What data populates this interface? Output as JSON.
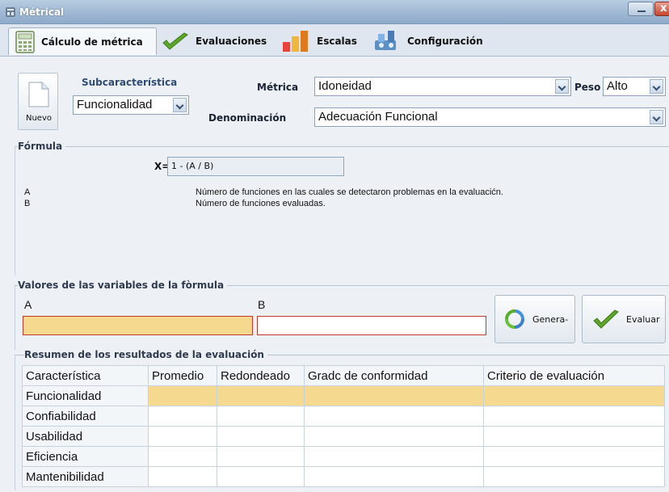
{
  "window": {
    "title": "Métrical",
    "close_glyph": "x"
  },
  "tabs": [
    {
      "label": "Cálculo de métrica",
      "icon": "calculator-icon"
    },
    {
      "label": "Evaluaciones",
      "icon": "checkmark-icon"
    },
    {
      "label": "Escalas",
      "icon": "bar-chart-icon"
    },
    {
      "label": "Configuración",
      "icon": "settings-icon"
    }
  ],
  "form": {
    "new_button": "Nuevo",
    "subcharacteristic_label": "Subcaracterística",
    "subcharacteristic_value": "Funcionalidad",
    "metric_label": "Métrica",
    "metric_value": "Idoneidad",
    "weight_label": "Peso",
    "weight_value": "Alto",
    "denomination_label": "Denominación",
    "denomination_value": "Adecuación Funcional"
  },
  "formula": {
    "section_title": "Fórmula",
    "x_label": "X=",
    "expression": "1 - (A / B)",
    "variables": [
      {
        "name": "A",
        "description": "Número de funciones en las cuales se detectaron problemas en la evaluacićn."
      },
      {
        "name": "B",
        "description": "Número de funciones evaluadas."
      }
    ]
  },
  "variables_section": {
    "title": "Valores de las variables de la fòrmula",
    "a_label": "A",
    "b_label": "B",
    "a_value": "",
    "b_value": "",
    "generate_button": "Genera-",
    "evaluate_button": "Evaluar"
  },
  "results": {
    "title": "Resumen de los resultados de la evaluación",
    "columns": [
      "Característica",
      "Promedio",
      "Redondeado",
      "Gradc de conformidad",
      "Criterio de evaluación"
    ],
    "rows": [
      {
        "name": "Funcionalidad",
        "cells": [
          "",
          "",
          "",
          ""
        ]
      },
      {
        "name": "Confiabilidad",
        "cells": [
          "",
          "",
          "",
          ""
        ]
      },
      {
        "name": "Usabilidad",
        "cells": [
          "",
          "",
          "",
          ""
        ]
      },
      {
        "name": "Eficiencia",
        "cells": [
          "",
          "",
          "",
          ""
        ]
      },
      {
        "name": "Mantenibilidad",
        "cells": [
          "",
          "",
          "",
          ""
        ]
      }
    ]
  },
  "colors": {
    "selected_row": "#f4d98e",
    "input_error_border": "#c0392b",
    "accent": "#2f4b75"
  }
}
